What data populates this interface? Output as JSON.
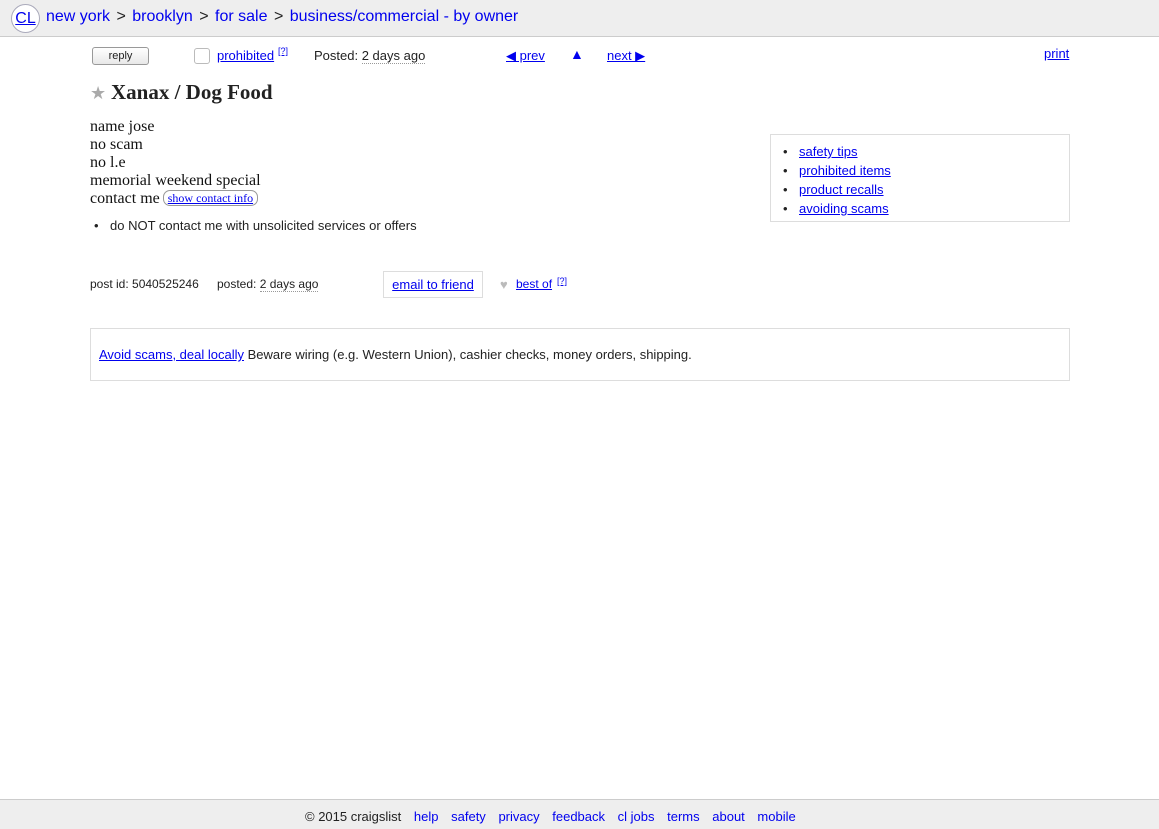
{
  "logo": {
    "text": "CL"
  },
  "breadcrumbs": [
    {
      "label": "new york"
    },
    {
      "label": "brooklyn"
    },
    {
      "label": "for sale"
    },
    {
      "label": "business/commercial - by owner"
    }
  ],
  "breadcrumb_separator": ">",
  "actions": {
    "reply_label": "reply",
    "prohibited_label": "prohibited",
    "help_marker": "[?]",
    "posted_label": "Posted:",
    "posted_time": "2 days ago",
    "prev_label": "◀ prev",
    "up_label": "▲",
    "next_label": "next ▶",
    "print_label": "print"
  },
  "posting": {
    "title": "Xanax / Dog Food",
    "body_lines": [
      "name jose",
      "no scam",
      "no l.e",
      "memorial weekend special"
    ],
    "contact_prefix": "contact me",
    "show_contact_label": "show contact info",
    "notices": [
      "do NOT contact me with unsolicited services or offers"
    ]
  },
  "safety_links": [
    "safety tips",
    "prohibited items",
    "product recalls",
    "avoiding scams"
  ],
  "postinfo": {
    "post_id_label": "post id: 5040525246",
    "posted_label": "posted:",
    "posted_time": "2 days ago",
    "email_label": "email to friend",
    "best_of_label": "best of",
    "help_marker": "[?]"
  },
  "scam_notice": {
    "link_label": "Avoid scams, deal locally",
    "text": "Beware wiring (e.g. Western Union), cashier checks, money orders, shipping."
  },
  "footer": {
    "copyright": "© 2015 craigslist",
    "links": [
      "help",
      "safety",
      "privacy",
      "feedback",
      "cl jobs",
      "terms",
      "about",
      "mobile"
    ]
  },
  "colors": {
    "link": "#0000ee",
    "bar_background": "#eeeeee",
    "box_border": "#dddddd",
    "text": "#222222"
  },
  "icons": {
    "star": "star-icon",
    "heart": "heart-icon",
    "flag": "checkbox-icon"
  }
}
